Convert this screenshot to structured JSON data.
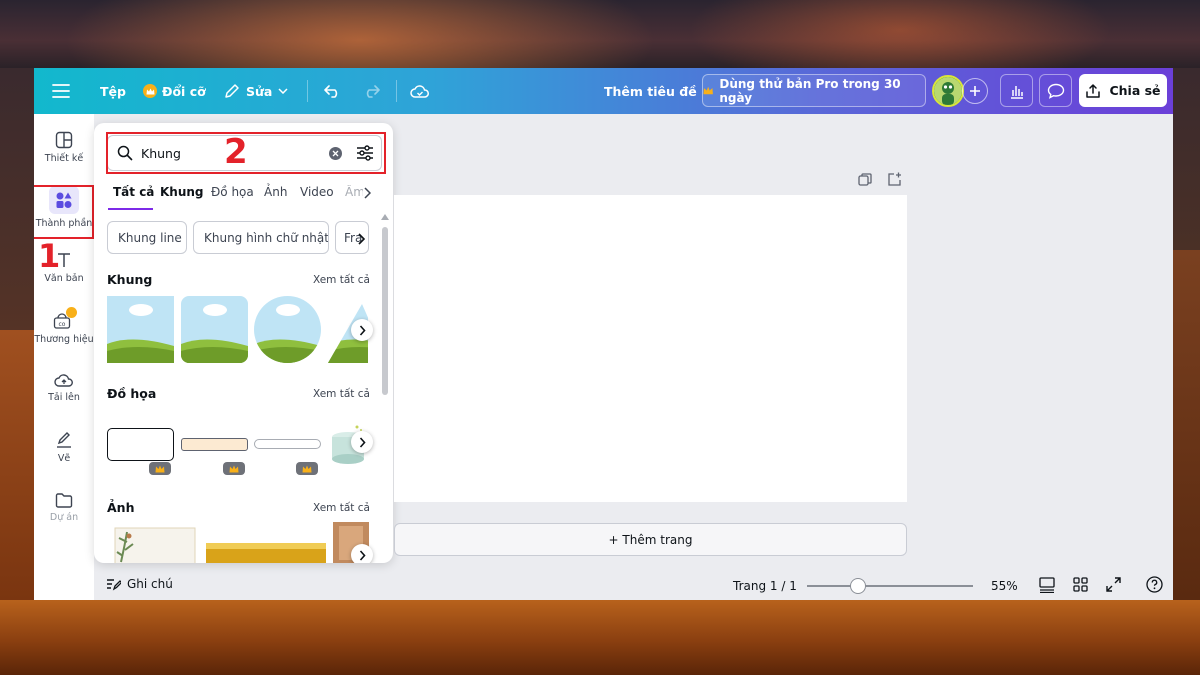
{
  "topbar": {
    "file_label": "Tệp",
    "resize_label": "Đổi cỡ",
    "edit_label": "Sửa",
    "add_title_label": "Thêm tiêu đề",
    "pro_trial_label": "Dùng thử bản Pro trong 30 ngày",
    "share_label": "Chia sẻ"
  },
  "sidebar": {
    "items": [
      {
        "label": "Thiết kế",
        "icon": "layout-icon"
      },
      {
        "label": "Thành phần",
        "icon": "elements-icon"
      },
      {
        "label": "Văn bản",
        "icon": "text-icon"
      },
      {
        "label": "Thương hiệu",
        "icon": "brand-icon"
      },
      {
        "label": "Tải lên",
        "icon": "upload-cloud-icon"
      },
      {
        "label": "Vẽ",
        "icon": "draw-icon"
      },
      {
        "label": "Dự án",
        "icon": "folder-icon"
      }
    ]
  },
  "annotations": {
    "step1": "1",
    "step2": "2"
  },
  "panel": {
    "search_value": "Khung",
    "tabs": [
      "Tất cả",
      "Khung",
      "Đồ họa",
      "Ảnh",
      "Video",
      "Âm"
    ],
    "chips": [
      "Khung line",
      "Khung hình chữ nhật",
      "Fra"
    ],
    "sections": {
      "frames": {
        "title": "Khung",
        "see_all": "Xem tất cả"
      },
      "graphics": {
        "title": "Đồ họa",
        "see_all": "Xem tất cả"
      },
      "photos": {
        "title": "Ảnh",
        "see_all": "Xem tất cả"
      }
    }
  },
  "canvas": {
    "add_page_label": "+ Thêm trang"
  },
  "bottombar": {
    "notes_label": "Ghi chú",
    "page_indicator": "Trang 1 / 1",
    "zoom_value": 55,
    "zoom_label": "55%"
  },
  "colors": {
    "accent": "#7d2ae8",
    "annotation": "#e3222a"
  }
}
